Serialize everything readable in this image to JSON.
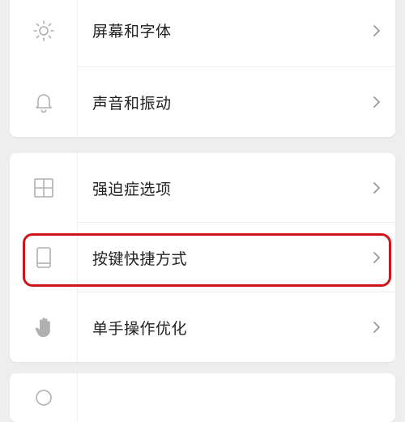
{
  "settings": {
    "groups": [
      {
        "items": [
          {
            "label": "屏幕和字体",
            "icon": "sun-icon"
          },
          {
            "label": "声音和振动",
            "icon": "bell-icon"
          }
        ]
      },
      {
        "items": [
          {
            "label": "强迫症选项",
            "icon": "grid-icon"
          },
          {
            "label": "按键快捷方式",
            "icon": "phone-icon",
            "highlighted": true
          },
          {
            "label": "单手操作优化",
            "icon": "hand-icon"
          }
        ]
      }
    ]
  },
  "colors": {
    "background": "#eeeeee",
    "card": "#ffffff",
    "highlight": "#d0141c",
    "icon": "#b0b0b0",
    "text": "#222222",
    "chevron": "#999999"
  }
}
